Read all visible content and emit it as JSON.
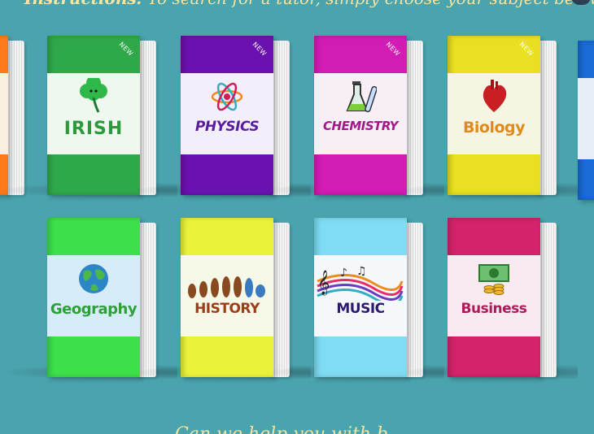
{
  "header": {
    "instruction_prefix": "Instructions:",
    "instruction_text": "To search for a tutor, simply choose your subject below."
  },
  "footer": {
    "text": "Can we help you with b..."
  },
  "books": {
    "irish": {
      "label": "IRISH",
      "badge": "NEW",
      "color": "#2fa84a",
      "label_color": "#2b9a3c",
      "band": "#eef8ee"
    },
    "physics": {
      "label": "PHYSICS",
      "badge": "NEW",
      "color": "#6a12b0",
      "label_color": "#5a1d9e",
      "band": "#f2eefa"
    },
    "chemistry": {
      "label": "CHEMISTRY",
      "badge": "NEW",
      "color": "#d21cb4",
      "label_color": "#a01a88",
      "band": "#f8eef6"
    },
    "biology": {
      "label": "Biology",
      "badge": "NEW",
      "color": "#e8e020",
      "label_color": "#e08a1c",
      "band": "#f6f5e4"
    },
    "geography": {
      "label": "Geography",
      "color": "#3de04a",
      "label_color": "#2ea03a",
      "band": "#d6ecf8"
    },
    "history": {
      "label": "HISTORY",
      "color": "#eaf33a",
      "label_color": "#9a3f1a",
      "band": "#f6f8e8"
    },
    "music": {
      "label": "MUSIC",
      "color": "#7fdcf2",
      "label_color": "#2d1a6e",
      "band": "#f4f8fb"
    },
    "business": {
      "label": "Business",
      "color": "#d4226b",
      "label_color": "#b01a5a",
      "band": "#f8eaf0"
    }
  }
}
